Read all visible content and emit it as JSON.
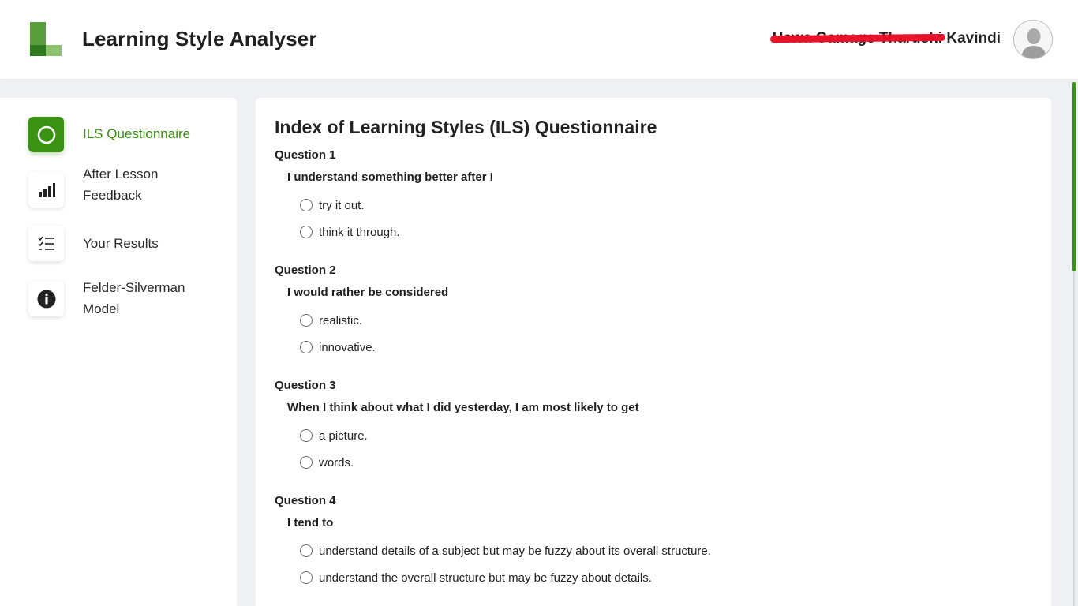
{
  "header": {
    "app_title": "Learning Style Analyser",
    "user_name_redacted": "Hewa Gamage Tharushi",
    "user_name_visible": "Kavindi",
    "avatar_icon": "user-silhouette-icon"
  },
  "sidebar": {
    "items": [
      {
        "label": "ILS Questionnaire",
        "icon": "circle-icon",
        "active": true
      },
      {
        "label": "After Lesson Feedback",
        "icon": "bar-chart-icon",
        "active": false
      },
      {
        "label": "Your Results",
        "icon": "checklist-icon",
        "active": false
      },
      {
        "label": "Felder-Silverman Model",
        "icon": "info-icon",
        "active": false
      }
    ]
  },
  "main": {
    "title": "Index of Learning Styles (ILS) Questionnaire",
    "questions": [
      {
        "number": "Question 1",
        "text": "I understand something better after I",
        "options": [
          "try it out.",
          "think it through."
        ]
      },
      {
        "number": "Question 2",
        "text": "I would rather be considered",
        "options": [
          "realistic.",
          "innovative."
        ]
      },
      {
        "number": "Question 3",
        "text": "When I think about what I did yesterday, I am most likely to get",
        "options": [
          "a picture.",
          "words."
        ]
      },
      {
        "number": "Question 4",
        "text": "I tend to",
        "options": [
          "understand details of a subject but may be fuzzy about its overall structure.",
          "understand the overall structure but may be fuzzy about details."
        ]
      }
    ]
  },
  "colors": {
    "accent": "#3a9213",
    "redaction": "#e8132a",
    "background": "#eef0f4"
  }
}
